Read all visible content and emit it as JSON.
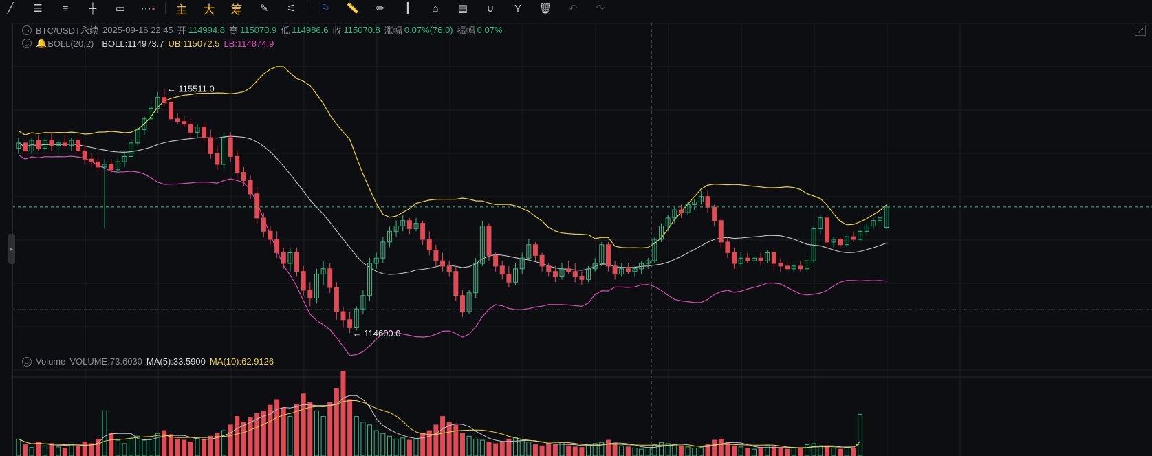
{
  "toolbar": {
    "draw_tools": [
      "line-tool-icon",
      "horizontal-lines-icon",
      "parallel-lines-icon",
      "crosshair-line-icon",
      "rectangle-icon",
      "more-icon"
    ],
    "modes": [
      "主",
      "大",
      "筹"
    ],
    "tools": [
      "brush-icon",
      "ruler-icon",
      "pencil-icon",
      "candles-icon",
      "lock-icon",
      "note-icon",
      "magnet-icon",
      "filter-icon",
      "trash-icon",
      "undo-icon",
      "redo-icon"
    ]
  },
  "main_legend": {
    "symbol": "BTC/USDT永续",
    "time": "2025-09-16 22:45",
    "open_label": "开",
    "open": "114994.8",
    "high_label": "高",
    "high": "115070.9",
    "low_label": "低",
    "low": "114986.6",
    "close_label": "收",
    "close": "115070.8",
    "change_label": "涨幅",
    "change": "0.07%(76.0)",
    "amp_label": "振幅",
    "amp": "0.07%"
  },
  "boll_legend": {
    "name": "BOLL(20,2)",
    "boll": "BOLL:114973.7",
    "ub": "UB:115072.5",
    "lb": "LB:114874.9"
  },
  "vol_legend": {
    "name": "Volume",
    "vol": "VOLUME:73.6030",
    "ma5": "MA(5):33.5900",
    "ma10": "MA(10):62.9126"
  },
  "colors": {
    "up": "#2ebd85",
    "down": "#e04b55",
    "ub": "#f0d43a",
    "lb": "#d94fb5",
    "mid": "#c8c8c8",
    "grid": "#1b1d22"
  },
  "chart_data": {
    "type": "candlestick",
    "symbol": "BTC/USDT永续",
    "high_marker": "115511.0",
    "low_marker": "114600.0",
    "price_range": [
      114580,
      115600
    ],
    "candles": [
      [
        115290,
        115330,
        115270,
        115310
      ],
      [
        115310,
        115320,
        115260,
        115280
      ],
      [
        115280,
        115330,
        115270,
        115320
      ],
      [
        115320,
        115340,
        115280,
        115290
      ],
      [
        115290,
        115330,
        115280,
        115320
      ],
      [
        115320,
        115350,
        115280,
        115300
      ],
      [
        115300,
        115320,
        115270,
        115310
      ],
      [
        115310,
        115340,
        115290,
        115300
      ],
      [
        115300,
        115330,
        115280,
        115320
      ],
      [
        115320,
        115330,
        115270,
        115280
      ],
      [
        115280,
        115300,
        115230,
        115250
      ],
      [
        115250,
        115270,
        115220,
        115240
      ],
      [
        115240,
        115260,
        115200,
        115220
      ],
      [
        115220,
        115250,
        114990,
        115230
      ],
      [
        115230,
        115250,
        115200,
        115210
      ],
      [
        115210,
        115260,
        115200,
        115240
      ],
      [
        115240,
        115280,
        115220,
        115260
      ],
      [
        115260,
        115320,
        115250,
        115310
      ],
      [
        115310,
        115370,
        115300,
        115360
      ],
      [
        115360,
        115410,
        115340,
        115400
      ],
      [
        115400,
        115460,
        115390,
        115440
      ],
      [
        115440,
        115500,
        115420,
        115480
      ],
      [
        115480,
        115511,
        115450,
        115460
      ],
      [
        115460,
        115480,
        115390,
        115400
      ],
      [
        115400,
        115420,
        115380,
        115390
      ],
      [
        115390,
        115410,
        115370,
        115380
      ],
      [
        115380,
        115400,
        115330,
        115350
      ],
      [
        115350,
        115380,
        115330,
        115370
      ],
      [
        115370,
        115390,
        115310,
        115330
      ],
      [
        115330,
        115360,
        115250,
        115270
      ],
      [
        115270,
        115300,
        115210,
        115230
      ],
      [
        115230,
        115350,
        115210,
        115330
      ],
      [
        115330,
        115350,
        115240,
        115260
      ],
      [
        115260,
        115280,
        115180,
        115200
      ],
      [
        115200,
        115220,
        115150,
        115170
      ],
      [
        115170,
        115190,
        115100,
        115120
      ],
      [
        115120,
        115140,
        115010,
        115030
      ],
      [
        115030,
        115050,
        114960,
        114980
      ],
      [
        114980,
        115000,
        114930,
        114950
      ],
      [
        114950,
        114980,
        114880,
        114900
      ],
      [
        114900,
        114920,
        114840,
        114860
      ],
      [
        114860,
        114920,
        114830,
        114900
      ],
      [
        114900,
        114920,
        114810,
        114830
      ],
      [
        114830,
        114850,
        114740,
        114760
      ],
      [
        114760,
        114790,
        114700,
        114730
      ],
      [
        114730,
        114840,
        114710,
        114820
      ],
      [
        114820,
        114870,
        114780,
        114840
      ],
      [
        114840,
        114860,
        114750,
        114770
      ],
      [
        114770,
        114790,
        114650,
        114680
      ],
      [
        114680,
        114700,
        114620,
        114650
      ],
      [
        114650,
        114680,
        114600,
        114620
      ],
      [
        114620,
        114700,
        114610,
        114690
      ],
      [
        114690,
        114760,
        114670,
        114740
      ],
      [
        114740,
        114880,
        114720,
        114860
      ],
      [
        114860,
        114900,
        114840,
        114880
      ],
      [
        114880,
        114960,
        114860,
        114940
      ],
      [
        114940,
        115000,
        114920,
        114980
      ],
      [
        114980,
        115020,
        114960,
        115000
      ],
      [
        115000,
        115040,
        114980,
        115020
      ],
      [
        115020,
        115030,
        114970,
        114990
      ],
      [
        114990,
        115030,
        114980,
        115010
      ],
      [
        115010,
        115020,
        114930,
        114950
      ],
      [
        114950,
        114980,
        114890,
        114910
      ],
      [
        114910,
        114930,
        114850,
        114870
      ],
      [
        114870,
        114900,
        114830,
        114850
      ],
      [
        114850,
        114870,
        114810,
        114830
      ],
      [
        114830,
        114850,
        114720,
        114740
      ],
      [
        114740,
        114760,
        114660,
        114680
      ],
      [
        114680,
        114760,
        114670,
        114750
      ],
      [
        114750,
        114880,
        114730,
        114860
      ],
      [
        114860,
        115020,
        114850,
        115000
      ],
      [
        115000,
        115010,
        114870,
        114890
      ],
      [
        114890,
        114900,
        114830,
        114850
      ],
      [
        114850,
        114870,
        114800,
        114820
      ],
      [
        114820,
        114850,
        114770,
        114790
      ],
      [
        114790,
        114860,
        114780,
        114840
      ],
      [
        114840,
        114900,
        114820,
        114880
      ],
      [
        114880,
        114950,
        114870,
        114930
      ],
      [
        114930,
        114940,
        114870,
        114890
      ],
      [
        114890,
        114900,
        114830,
        114850
      ],
      [
        114850,
        114860,
        114810,
        114830
      ],
      [
        114830,
        114850,
        114790,
        114810
      ],
      [
        114810,
        114860,
        114800,
        114840
      ],
      [
        114840,
        114870,
        114820,
        114830
      ],
      [
        114830,
        114860,
        114790,
        114810
      ],
      [
        114810,
        114830,
        114780,
        114800
      ],
      [
        114800,
        114850,
        114790,
        114840
      ],
      [
        114840,
        114880,
        114830,
        114860
      ],
      [
        114860,
        114940,
        114850,
        114930
      ],
      [
        114930,
        114940,
        114830,
        114850
      ],
      [
        114850,
        114870,
        114800,
        114820
      ],
      [
        114820,
        114860,
        114810,
        114840
      ],
      [
        114840,
        114860,
        114820,
        114830
      ],
      [
        114830,
        114850,
        114810,
        114840
      ],
      [
        114840,
        114870,
        114820,
        114860
      ],
      [
        114860,
        114880,
        114840,
        114870
      ],
      [
        114870,
        114960,
        114860,
        114950
      ],
      [
        114950,
        115010,
        114940,
        115000
      ],
      [
        115000,
        115040,
        114980,
        115030
      ],
      [
        115030,
        115070,
        115010,
        115060
      ],
      [
        115060,
        115080,
        115030,
        115050
      ],
      [
        115050,
        115090,
        115040,
        115080
      ],
      [
        115080,
        115100,
        115060,
        115090
      ],
      [
        115090,
        115130,
        115080,
        115110
      ],
      [
        115110,
        115130,
        115050,
        115070
      ],
      [
        115070,
        115080,
        115000,
        115020
      ],
      [
        115020,
        115030,
        114920,
        114940
      ],
      [
        114940,
        114960,
        114880,
        114900
      ],
      [
        114900,
        114920,
        114840,
        114860
      ],
      [
        114860,
        114900,
        114850,
        114880
      ],
      [
        114880,
        114900,
        114860,
        114870
      ],
      [
        114870,
        114890,
        114860,
        114880
      ],
      [
        114880,
        114900,
        114850,
        114870
      ],
      [
        114870,
        114910,
        114860,
        114900
      ],
      [
        114900,
        114910,
        114840,
        114860
      ],
      [
        114860,
        114880,
        114830,
        114850
      ],
      [
        114850,
        114870,
        114830,
        114840
      ],
      [
        114840,
        114860,
        114830,
        114850
      ],
      [
        114850,
        114870,
        114830,
        114840
      ],
      [
        114840,
        114880,
        114830,
        114870
      ],
      [
        114870,
        115000,
        114860,
        114990
      ],
      [
        114990,
        115040,
        114970,
        115030
      ],
      [
        115030,
        115040,
        114920,
        114940
      ],
      [
        114940,
        114960,
        114920,
        114950
      ],
      [
        114950,
        114960,
        114920,
        114930
      ],
      [
        114930,
        114970,
        114920,
        114960
      ],
      [
        114960,
        114980,
        114940,
        114950
      ],
      [
        114950,
        114990,
        114940,
        114980
      ],
      [
        114980,
        115010,
        114970,
        115000
      ],
      [
        115000,
        115030,
        114990,
        115020
      ],
      [
        115020,
        115040,
        115000,
        115030
      ],
      [
        114995,
        115071,
        114987,
        115071
      ]
    ],
    "volume": {
      "current": 73.603,
      "ma5": 33.59,
      "ma10": 62.9126,
      "values": [
        30,
        20,
        15,
        25,
        18,
        22,
        16,
        14,
        20,
        18,
        25,
        22,
        30,
        80,
        40,
        28,
        22,
        30,
        35,
        28,
        30,
        40,
        45,
        38,
        30,
        28,
        25,
        32,
        30,
        35,
        40,
        45,
        55,
        70,
        60,
        68,
        75,
        80,
        90,
        100,
        85,
        70,
        92,
        110,
        95,
        80,
        70,
        95,
        120,
        150,
        100,
        70,
        60,
        55,
        45,
        40,
        35,
        30,
        32,
        28,
        30,
        40,
        45,
        55,
        70,
        60,
        55,
        40,
        35,
        30,
        28,
        25,
        22,
        24,
        30,
        32,
        28,
        25,
        20,
        18,
        22,
        20,
        24,
        18,
        16,
        15,
        20,
        22,
        24,
        28,
        22,
        18,
        16,
        14,
        12,
        15,
        20,
        24,
        22,
        20,
        18,
        16,
        14,
        15,
        20,
        28,
        30,
        24,
        18,
        16,
        14,
        12,
        15,
        18,
        16,
        14,
        12,
        15,
        14,
        20,
        22,
        18,
        16,
        14,
        12,
        15,
        14,
        74
      ]
    }
  }
}
